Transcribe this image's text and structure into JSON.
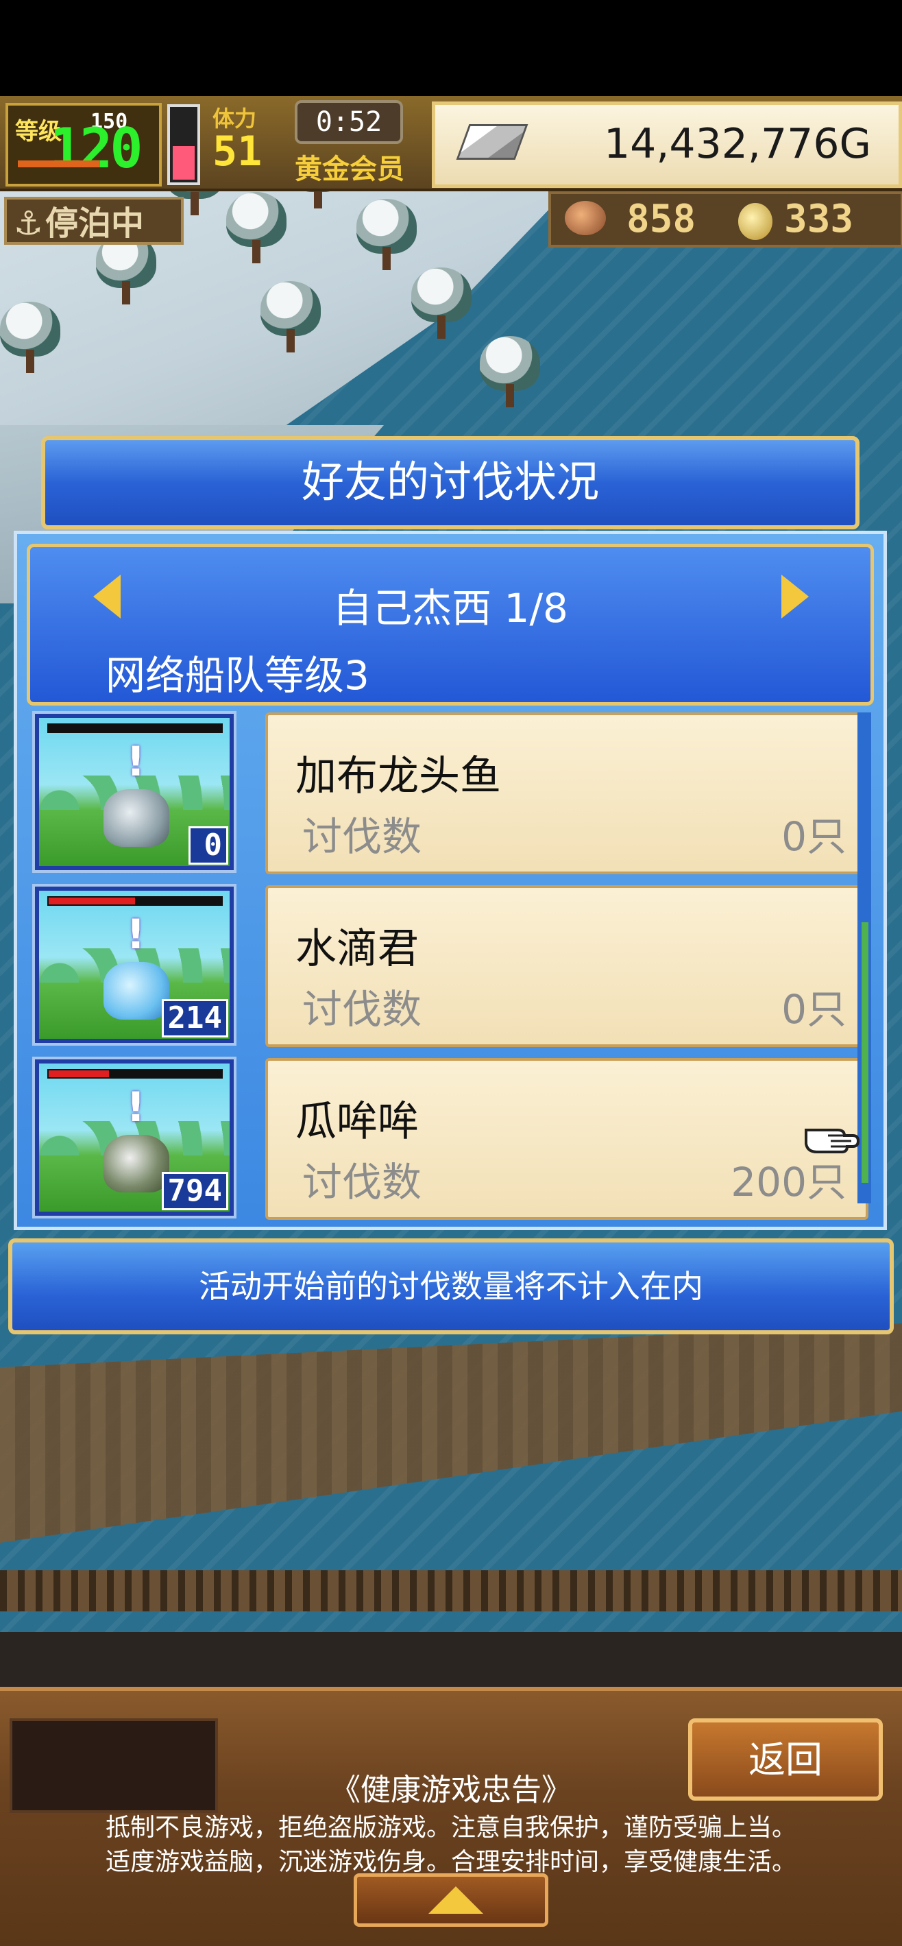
{
  "hud": {
    "level_label": "等级",
    "level_max": "150",
    "level_current": "120",
    "stamina_label": "体力",
    "stamina_value": "51",
    "stamina_level": 0.45,
    "timer": "0:52",
    "membership": "黄金会员",
    "money": "14,432,776G",
    "status": "停泊中",
    "food": "858",
    "medals": "333"
  },
  "dialog": {
    "title": "好友的讨伐状况",
    "player": "自己杰西 1/8",
    "fleet_level": "网络船队等级3",
    "rows": [
      {
        "name": "加布龙头鱼",
        "kill_label": "讨伐数",
        "kill_value": "0只",
        "badge": "0",
        "hp": 1.0,
        "hp_color": "#111111",
        "monster": "gray"
      },
      {
        "name": "水滴君",
        "kill_label": "讨伐数",
        "kill_value": "0只",
        "badge": "214",
        "hp": 0.5,
        "hp_color": "#e02020",
        "monster": "blue"
      },
      {
        "name": "瓜哞哞",
        "kill_label": "讨伐数",
        "kill_value": "200只",
        "badge": "794",
        "hp": 0.35,
        "hp_color": "#e02020",
        "monster": "dark"
      }
    ],
    "notice": "活动开始前的讨伐数量将不计入在内"
  },
  "bottom": {
    "back": "返回",
    "advice_title": "《健康游戏忠告》",
    "advice_line1": "抵制不良游戏，拒绝盗版游戏。注意自我保护，谨防受骗上当。",
    "advice_line2": "适度游戏益脑，沉迷游戏伤身。合理安排时间，享受健康生活。"
  },
  "icons": [
    "anchor-icon",
    "money-bar-icon",
    "food-icon",
    "medal-icon",
    "arrow-left-icon",
    "arrow-right-icon",
    "pointer-hand-icon",
    "up-arrow-icon"
  ],
  "colors": {
    "panel_blue": "#2a63d6",
    "gold_border": "#e6c66e",
    "parchment": "#fbf0d4",
    "hp_red": "#e02020"
  }
}
